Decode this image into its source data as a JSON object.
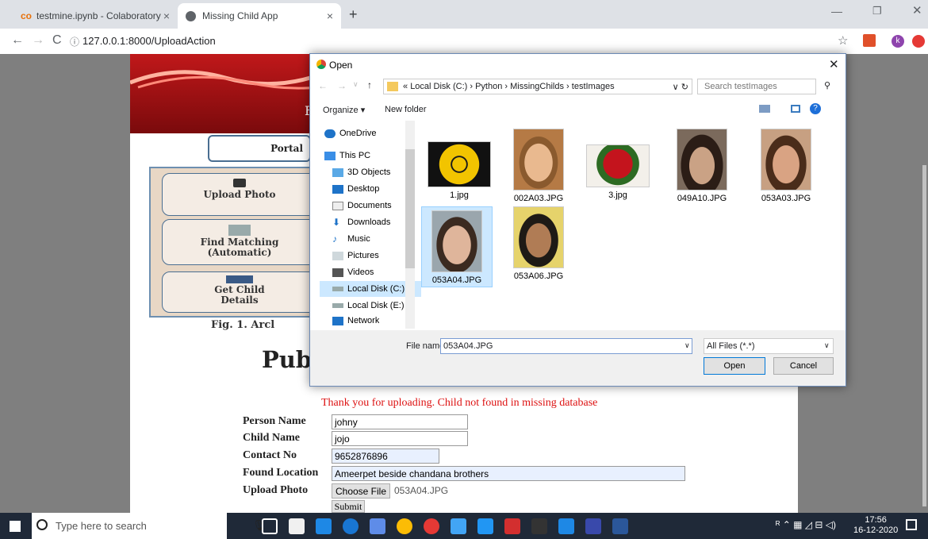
{
  "tabs": [
    {
      "label": "testmine.ipynb - Colaboratory"
    },
    {
      "label": "Missing Child App"
    }
  ],
  "address": {
    "url": "127.0.0.1:8000/UploadAction"
  },
  "page": {
    "portal_text": "Portal",
    "banner_letter": "F",
    "diagram": {
      "upload": "Upload Photo",
      "find": "Find Matching (Automatic)",
      "get": "Get Child Details"
    },
    "figure_caption": "Fig. 1.   Arcl",
    "title": "Publ",
    "message": "Thank you for uploading. Child not found in missing database",
    "labels": {
      "person": "Person Name",
      "child": "Child Name",
      "contact": "Contact No",
      "location": "Found Location",
      "photo": "Upload Photo"
    },
    "values": {
      "person": "johny",
      "child": "jojo",
      "contact": "9652876896",
      "location": "Ameerpet beside chandana brothers"
    },
    "choose_file": "Choose File",
    "chosen_file": "053A04.JPG",
    "submit": "Submit"
  },
  "dialog": {
    "title": "Open",
    "path": [
      "Local Disk (C:)",
      "Python",
      "MissingChilds",
      "testImages"
    ],
    "search_placeholder": "Search testImages",
    "organize": "Organize ▾",
    "new_folder": "New folder",
    "sidebar": [
      "OneDrive",
      "This PC",
      "3D Objects",
      "Desktop",
      "Documents",
      "Downloads",
      "Music",
      "Pictures",
      "Videos",
      "Local Disk (C:)",
      "Local Disk (E:)",
      "Network"
    ],
    "files": [
      "1.jpg",
      "002A03.JPG",
      "3.jpg",
      "049A10.JPG",
      "053A03.JPG",
      "053A04.JPG",
      "053A06.JPG"
    ],
    "file_name_label": "File name:",
    "file_name_value": "053A04.JPG",
    "filter": "All Files (*.*)",
    "open": "Open",
    "cancel": "Cancel"
  },
  "taskbar": {
    "search": "Type here to search",
    "time": "17:56",
    "date": "16-12-2020"
  }
}
